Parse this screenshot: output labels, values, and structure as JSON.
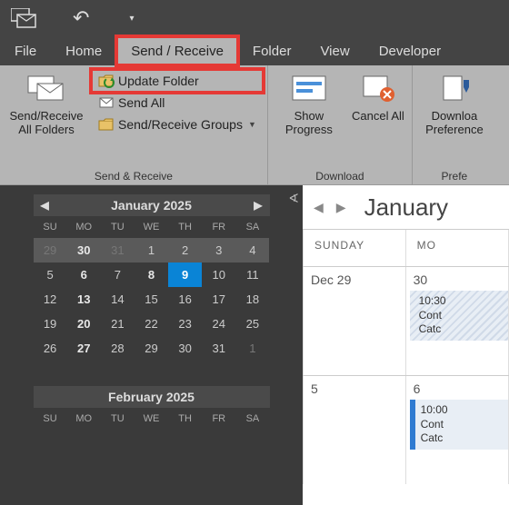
{
  "tabs": {
    "file": "File",
    "home": "Home",
    "sendreceive": "Send / Receive",
    "folder": "Folder",
    "view": "View",
    "developer": "Developer"
  },
  "ribbon": {
    "group1_label": "Send & Receive",
    "sendreceive_all": "Send/Receive All Folders",
    "update_folder": "Update Folder",
    "send_all": "Send All",
    "groups": "Send/Receive Groups",
    "group2_label": "Download",
    "show_progress": "Show Progress",
    "cancel_all": "Cancel All",
    "group3_label": "Prefe",
    "download_pref": "Downloa Preference"
  },
  "mini_cal1": {
    "title": "January 2025",
    "dow": [
      "SU",
      "MO",
      "TU",
      "WE",
      "TH",
      "FR",
      "SA"
    ],
    "weeks": [
      [
        {
          "n": 29,
          "o": true
        },
        {
          "n": 30,
          "o": true,
          "b": true
        },
        {
          "n": 31,
          "o": true
        },
        {
          "n": 1
        },
        {
          "n": 2
        },
        {
          "n": 3
        },
        {
          "n": 4
        }
      ],
      [
        {
          "n": 5
        },
        {
          "n": 6,
          "b": true
        },
        {
          "n": 7
        },
        {
          "n": 8,
          "b": true
        },
        {
          "n": 9,
          "sel": true
        },
        {
          "n": 10
        },
        {
          "n": 11
        }
      ],
      [
        {
          "n": 12
        },
        {
          "n": 13,
          "b": true
        },
        {
          "n": 14
        },
        {
          "n": 15
        },
        {
          "n": 16
        },
        {
          "n": 17
        },
        {
          "n": 18
        }
      ],
      [
        {
          "n": 19
        },
        {
          "n": 20,
          "b": true
        },
        {
          "n": 21
        },
        {
          "n": 22
        },
        {
          "n": 23
        },
        {
          "n": 24
        },
        {
          "n": 25
        }
      ],
      [
        {
          "n": 26
        },
        {
          "n": 27,
          "b": true
        },
        {
          "n": 28
        },
        {
          "n": 29
        },
        {
          "n": 30
        },
        {
          "n": 31
        },
        {
          "n": 1,
          "o": true
        }
      ]
    ]
  },
  "mini_cal2": {
    "title": "February 2025",
    "dow": [
      "SU",
      "MO",
      "TU",
      "WE",
      "TH",
      "FR",
      "SA"
    ]
  },
  "content": {
    "title": "January ",
    "dow": [
      "SUNDAY",
      "MO"
    ],
    "rows": [
      {
        "cells": [
          {
            "label": "Dec 29"
          },
          {
            "label": "30",
            "event": {
              "time": "10:30",
              "l1": "Cont",
              "l2": "Catc",
              "hatched": true
            }
          }
        ]
      },
      {
        "cells": [
          {
            "label": "5"
          },
          {
            "label": "6",
            "event": {
              "time": "10:00",
              "l1": "Cont",
              "l2": "Catc"
            }
          }
        ]
      }
    ]
  }
}
